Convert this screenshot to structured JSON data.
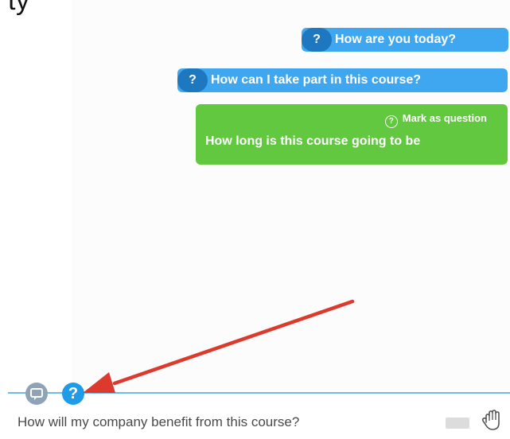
{
  "top": {
    "cut_text": "ty"
  },
  "messages": [
    {
      "type": "question",
      "text": "How are you today?",
      "icon": "question-icon"
    },
    {
      "type": "question",
      "text": "How can I take part in this course?",
      "icon": "question-icon"
    },
    {
      "type": "message",
      "mark_label": "Mark as question",
      "mark_icon": "question-outline-icon",
      "text": "How long is this course going to be"
    }
  ],
  "composer": {
    "chat_icon": "chat-icon",
    "qa_icon": "question-icon",
    "qa_symbol": "?",
    "input_value": "How will my company benefit from this course?",
    "send_toggle_icon": "send-toggle",
    "raise_hand_icon": "raise-hand-icon"
  },
  "colors": {
    "question_bubble": "#3fa7ef",
    "question_circle": "#1e78bf",
    "message_bubble": "#62c83f",
    "qa_active": "#1f9be8",
    "chat_inactive": "#8fa3b8",
    "annotation_arrow": "#dd3a2e",
    "divider": "#6bbcec"
  }
}
